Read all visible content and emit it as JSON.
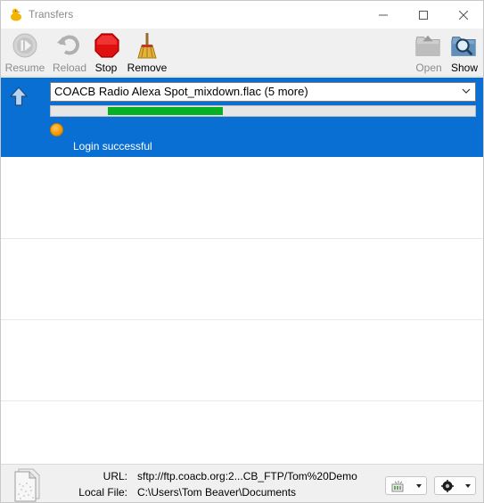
{
  "window": {
    "title": "Transfers",
    "controls": {
      "minimize": "—",
      "maximize": "☐",
      "close": "✕"
    }
  },
  "toolbar": {
    "resume": {
      "label": "Resume",
      "icon": "resume-icon",
      "enabled": false
    },
    "reload": {
      "label": "Reload",
      "icon": "reload-icon",
      "enabled": false
    },
    "stop": {
      "label": "Stop",
      "icon": "stop-icon",
      "enabled": true
    },
    "remove": {
      "label": "Remove",
      "icon": "broom-icon",
      "enabled": true
    },
    "open": {
      "label": "Open",
      "icon": "folder-icon",
      "enabled": false
    },
    "show": {
      "label": "Show",
      "icon": "magnifier-folder-icon",
      "enabled": true
    }
  },
  "transfer": {
    "direction": "upload",
    "file_selection": "COACB Radio Alexa Spot_mixdown.flac (5 more)",
    "progress_fraction": 0.27,
    "status": "Login successful",
    "status_color": "#f39a00",
    "row_color": "#0a6fd2",
    "progress_color": "#06b025"
  },
  "footer": {
    "url_label": "URL:",
    "url_value": "sftp://ftp.coacb.org:2...CB_FTP/Tom%20Demo",
    "local_label": "Local File:",
    "local_value": "C:\\Users\\Tom Beaver\\Documents",
    "bandwidth_icon": "bandwidth-icon",
    "connections_icon": "connections-icon"
  }
}
